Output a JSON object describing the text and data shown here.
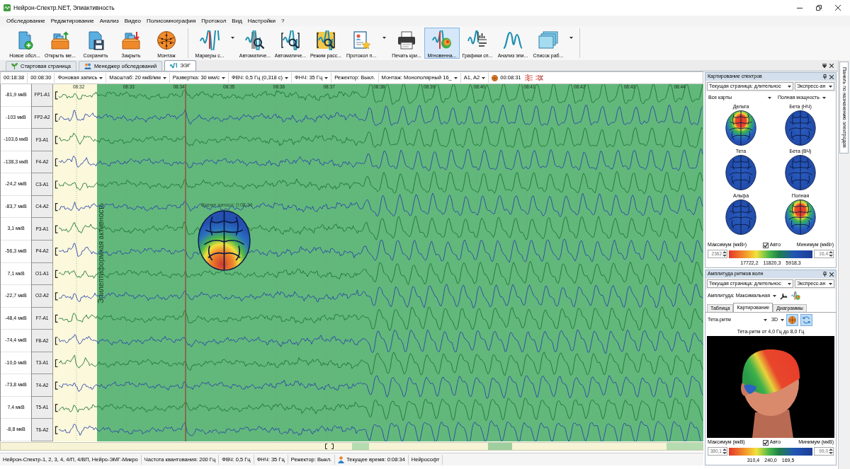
{
  "window": {
    "title": "Нейрон-Спектр.NET, Эпиактивность"
  },
  "menu": [
    "Обследование",
    "Редактирование",
    "Анализ",
    "Видео",
    "Полисомнография",
    "Протокол",
    "Вид",
    "Настройки",
    "?"
  ],
  "toolbar": [
    {
      "items": [
        {
          "label": "Новое обсл...",
          "selected": false,
          "dropdown": false
        },
        {
          "label": "Открыть ме...",
          "selected": false,
          "dropdown": false
        },
        {
          "label": "Сохранить",
          "selected": false,
          "dropdown": false
        },
        {
          "label": "Закрыть",
          "selected": false,
          "dropdown": false
        },
        {
          "label": "Монтаж",
          "selected": false,
          "dropdown": false
        }
      ]
    },
    {
      "items": [
        {
          "label": "Маркеры с...",
          "selected": false,
          "dropdown": true
        },
        {
          "label": "Автоматиче...",
          "selected": false,
          "dropdown": false
        },
        {
          "label": "Автоматиче...",
          "selected": false,
          "dropdown": false
        },
        {
          "label": "Режим расс...",
          "selected": false,
          "dropdown": false
        },
        {
          "label": "Протокол п...",
          "selected": false,
          "dropdown": true
        },
        {
          "label": "Печать кри...",
          "selected": false,
          "dropdown": false
        },
        {
          "label": "Мгновенна...",
          "selected": true,
          "dropdown": false
        },
        {
          "label": "Графики сп...",
          "selected": false,
          "dropdown": false
        },
        {
          "label": "Анализ эпи...",
          "selected": false,
          "dropdown": false
        },
        {
          "label": "Список раб...",
          "selected": false,
          "dropdown": true
        }
      ]
    }
  ],
  "doc_tabs": [
    {
      "label": "Стартовая страница",
      "selected": false
    },
    {
      "label": "Менеджер обследований",
      "selected": false
    },
    {
      "label": "ЭЭГ",
      "selected": true
    }
  ],
  "eeg": {
    "controls": [
      {
        "kind": "time",
        "text": "00:18:38"
      },
      {
        "kind": "time",
        "text": "00:08:30"
      },
      {
        "kind": "dropdown",
        "text": "Фоновая запись"
      },
      {
        "kind": "dropdown",
        "text": "Масштаб: 20 мкВ/мм"
      },
      {
        "kind": "dropdown",
        "text": "Развертка: 30 мм/с"
      },
      {
        "kind": "dropdown",
        "text": "ФВЧ: 0,5 Гц (0,318 с)"
      },
      {
        "kind": "dropdown",
        "text": "ФНЧ: 35 Гц"
      },
      {
        "kind": "label",
        "text": "Режектор: Выкл."
      },
      {
        "kind": "dropdown",
        "text": "Монтаж: Монополярный 16_"
      },
      {
        "kind": "dropdown",
        "text": "А1, А2"
      },
      {
        "kind": "timer",
        "text": "00:08:31"
      }
    ],
    "time_labels": [
      "08:32",
      "08:33",
      "08:34",
      "08:35",
      "08:36",
      "08:37",
      "08:38",
      "08:39",
      "08:40",
      "08:41",
      "08:42",
      "08:43",
      "08:44"
    ],
    "channels": [
      {
        "label": "FP1-A1",
        "amplitude": "-81,9 мкВ",
        "color": "#1d7434"
      },
      {
        "label": "FP2-A2",
        "amplitude": "-103 мкВ",
        "color": "#2a45a8"
      },
      {
        "label": "F3-A1",
        "amplitude": "-103,6 мкВ",
        "color": "#1d7434"
      },
      {
        "label": "F4-A2",
        "amplitude": "-138,3 мкВ",
        "color": "#2a45a8"
      },
      {
        "label": "C3-A1",
        "amplitude": "-24,2 мкВ",
        "color": "#1d7434"
      },
      {
        "label": "C4-A2",
        "amplitude": "-83,7 мкВ",
        "color": "#2a45a8"
      },
      {
        "label": "P3-A1",
        "amplitude": "3,1 мкВ",
        "color": "#1d7434"
      },
      {
        "label": "P4-A2",
        "amplitude": "-56,3 мкВ",
        "color": "#2a45a8"
      },
      {
        "label": "O1-A1",
        "amplitude": "7,1 мкВ",
        "color": "#1d7434"
      },
      {
        "label": "O2-A2",
        "amplitude": "-22,7 мкВ",
        "color": "#2a45a8"
      },
      {
        "label": "F7-A1",
        "amplitude": "-48,4 мкВ",
        "color": "#1d7434"
      },
      {
        "label": "F8-A2",
        "amplitude": "-74,4 мкВ",
        "color": "#2a45a8"
      },
      {
        "label": "T3-A1",
        "amplitude": "-10,6 мкВ",
        "color": "#1d7434"
      },
      {
        "label": "T4-A2",
        "amplitude": "-73,8 мкВ",
        "color": "#2a45a8"
      },
      {
        "label": "T5-A1",
        "amplitude": "7,4 мкВ",
        "color": "#1d7434"
      },
      {
        "label": "T6-A2",
        "amplitude": "-8,8 мкВ",
        "color": "#2a45a8"
      }
    ],
    "marker": {
      "label": "Эпилептиформная активность"
    },
    "cursor": {
      "label": "Время записи: 0:08:34"
    }
  },
  "status_bar": [
    {
      "kind": "text",
      "text": "Нейрон-Спектр-1, 2, 3, 4, 4/П, 4/ВП, Нейро-ЭМГ-Микро"
    },
    {
      "kind": "text",
      "text": "Частота квантования: 200 Гц"
    },
    {
      "kind": "text",
      "text": "ФВЧ: 0,5 Гц"
    },
    {
      "kind": "text",
      "text": "ФНЧ: 35 Гц"
    },
    {
      "kind": "text",
      "text": "Режектор: Выкл."
    },
    {
      "kind": "time",
      "text": "Текущее время: 0:08:34"
    },
    {
      "kind": "text",
      "text": "Нейрософт"
    }
  ],
  "spectrum_panel": {
    "title": "Картирование спектров",
    "page_select": "Текущая страница: длительнос",
    "mode_select": "Экспресс-ан",
    "maps_select": "Все карты",
    "power_select": "Полная мощность",
    "maps": [
      {
        "label": "Дельта",
        "kind": "peak"
      },
      {
        "label": "Бета (НЧ)",
        "kind": "flat"
      },
      {
        "label": "Тета",
        "kind": "flat"
      },
      {
        "label": "Бета (ВЧ)",
        "kind": "flat"
      },
      {
        "label": "Альфа",
        "kind": "flat"
      },
      {
        "label": "Полная",
        "kind": "peak"
      }
    ],
    "scale": {
      "max_label": "Максимум (мкВ²)",
      "auto_label": "Авто",
      "auto_checked": true,
      "min_label": "Минимум (мкВ²)",
      "max_value": "2362",
      "min_value": "16,4",
      "ticks": [
        "17722,2",
        "11820,3",
        "5918,3"
      ]
    }
  },
  "amplitude_panel": {
    "title": "Амплитуда ритмов волн",
    "page_select": "Текущая страница: длительнос",
    "mode_select": "Экспресс-ан",
    "amplitude_select": "Амплитуда: Максимальная",
    "tabs": [
      {
        "label": "Таблица",
        "selected": false
      },
      {
        "label": "Картирование",
        "selected": true
      },
      {
        "label": "Диаграммы",
        "selected": false
      }
    ],
    "rhythm_select": "Тета-ритм",
    "view_select": "3D",
    "view_buttons": [
      {
        "selected": true
      },
      {
        "selected": true
      }
    ],
    "caption": "Тета-ритм от 4,0 Гц до 8,0 Гц",
    "scale": {
      "max_label": "Максимум (мкВ)",
      "auto_label": "Авто",
      "auto_checked": true,
      "min_label": "Минимум (мкВ)",
      "max_value": "380,1",
      "min_value": "99,0",
      "ticks": [
        "310,4",
        "240,0",
        "169,5"
      ]
    }
  },
  "side_tab": {
    "label": "Панель по назначению электродов"
  }
}
